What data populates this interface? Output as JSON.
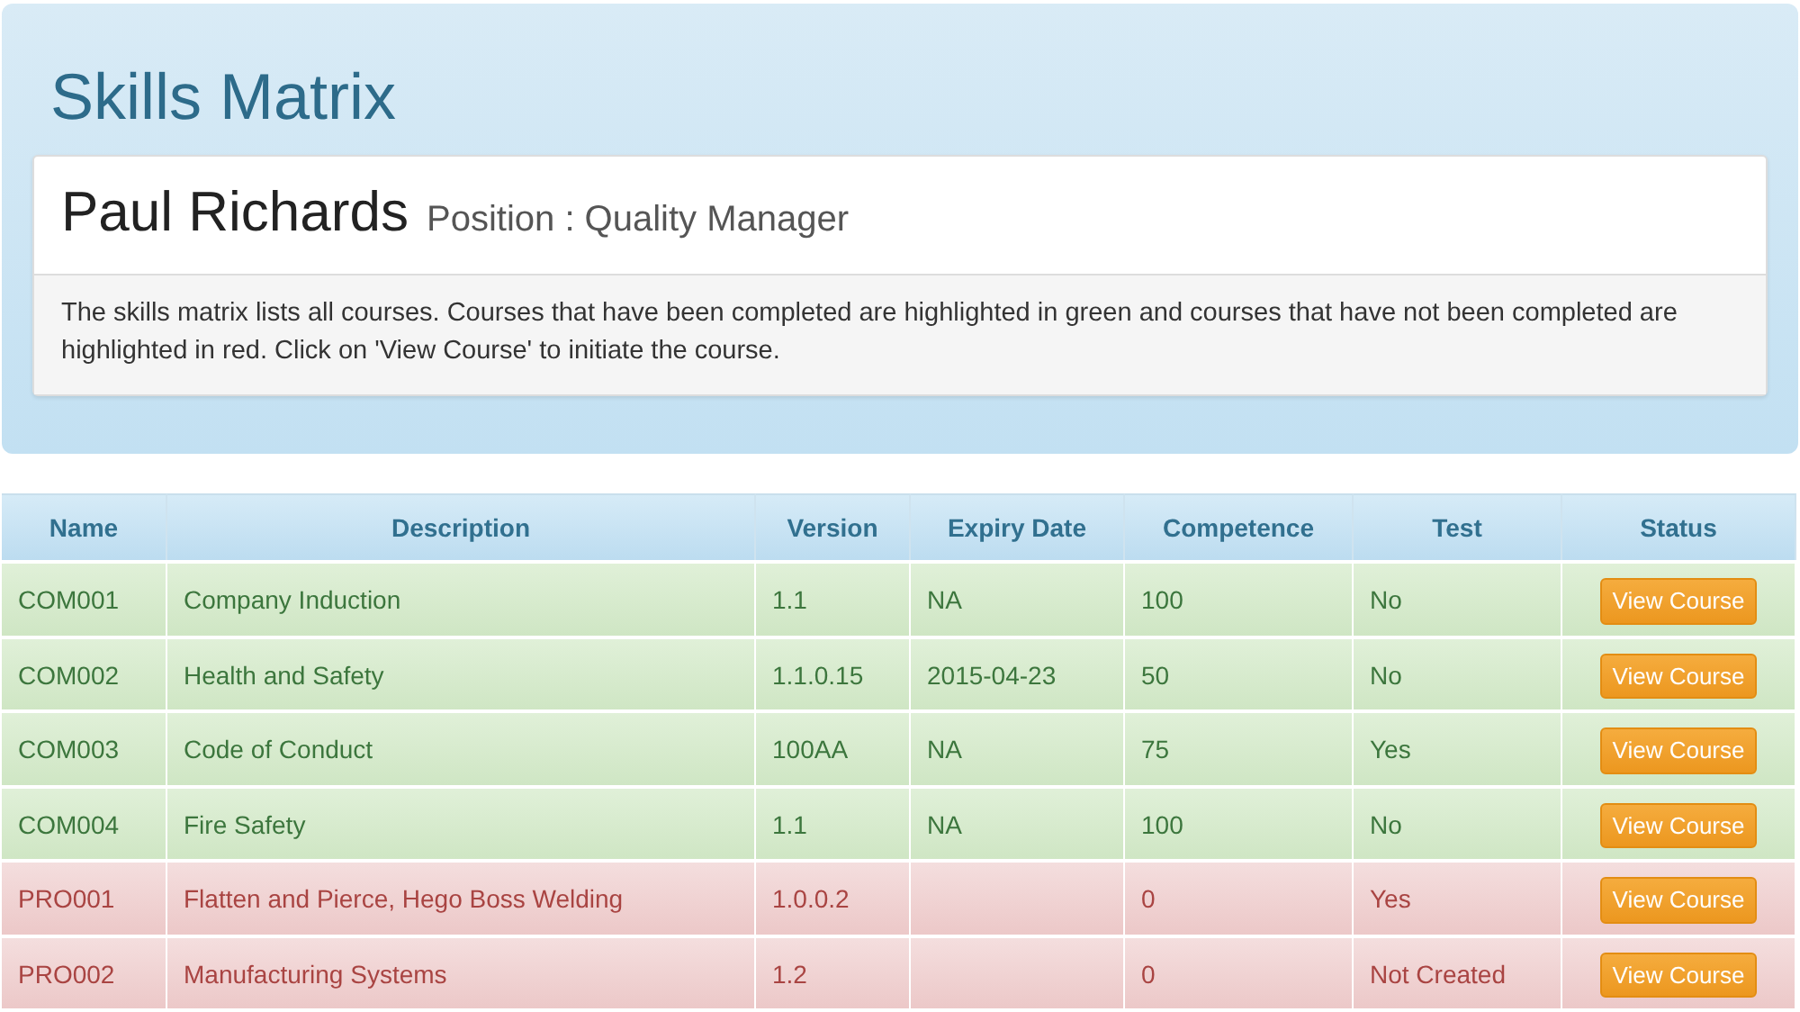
{
  "header": {
    "title": "Skills Matrix"
  },
  "profile": {
    "name": "Paul Richards",
    "position": "Position : Quality Manager",
    "description": "The skills matrix lists all courses. Courses that have been completed are highlighted in green and courses that have not been completed are highlighted in red. Click on 'View Course' to initiate the course."
  },
  "table": {
    "columns": [
      "Name",
      "Description",
      "Version",
      "Expiry Date",
      "Competence",
      "Test",
      "Status"
    ],
    "rows": [
      {
        "name": "COM001",
        "description": "Company Induction",
        "version": "1.1",
        "expiry": "NA",
        "competence": "100",
        "test": "No",
        "button": "View Course",
        "completed": true
      },
      {
        "name": "COM002",
        "description": "Health and Safety",
        "version": "1.1.0.15",
        "expiry": "2015-04-23",
        "competence": "50",
        "test": "No",
        "button": "View Course",
        "completed": true
      },
      {
        "name": "COM003",
        "description": "Code of Conduct",
        "version": "100AA",
        "expiry": "NA",
        "competence": "75",
        "test": "Yes",
        "button": "View Course",
        "completed": true
      },
      {
        "name": "COM004",
        "description": "Fire Safety",
        "version": "1.1",
        "expiry": "NA",
        "competence": "100",
        "test": "No",
        "button": "View Course",
        "completed": true
      },
      {
        "name": "PRO001",
        "description": "Flatten and Pierce, Hego Boss Welding",
        "version": "1.0.0.2",
        "competence": "0",
        "test": "Yes",
        "button": "View Course",
        "completed": false
      },
      {
        "name": "PRO002",
        "description": "Manufacturing Systems",
        "version": "1.2",
        "competence": "0",
        "test": "Not Created",
        "button": "View Course",
        "completed": false
      }
    ]
  }
}
